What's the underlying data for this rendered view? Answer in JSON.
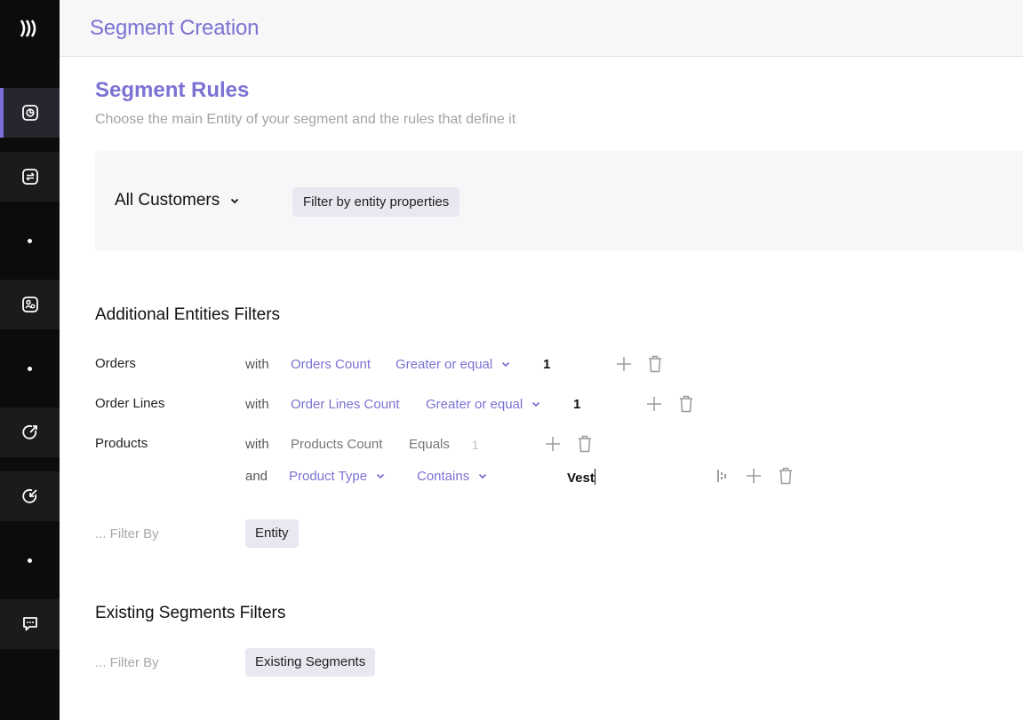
{
  "header": {
    "title": "Segment Creation"
  },
  "rules": {
    "title": "Segment Rules",
    "subtitle": "Choose the main Entity of your segment and the rules that define it",
    "entity": "All Customers",
    "filter_button": "Filter by entity properties"
  },
  "additional": {
    "title": "Additional Entities Filters",
    "rows": [
      {
        "entity": "Orders",
        "connector": "with",
        "field": "Orders Count",
        "operator": "Greater or equal",
        "value": "1"
      },
      {
        "entity": "Order Lines",
        "connector": "with",
        "field": "Order Lines Count",
        "operator": "Greater or equal",
        "value": "1"
      },
      {
        "entity": "Products",
        "connector": "with",
        "field": "Products Count",
        "operator": "Equals",
        "value": "1"
      }
    ],
    "and_row": {
      "connector": "and",
      "field": "Product Type",
      "operator": "Contains",
      "value": "Vest"
    },
    "filter_by_label": "... Filter By",
    "filter_by_button": "Entity"
  },
  "existing": {
    "title": "Existing Segments Filters",
    "filter_by_label": "... Filter By",
    "filter_by_button": "Existing Segments"
  },
  "colors": {
    "accent": "#7b72d3",
    "sidebar": "#0c0c0c",
    "chip": "#e8e8f0"
  },
  "icons": {
    "logo": "waves-logo",
    "nav": [
      "segments-icon",
      "exchange-icon",
      "dot",
      "audience-icon",
      "dot",
      "export-icon",
      "import-icon",
      "dot",
      "chat-icon"
    ],
    "row_actions": [
      "plus-icon",
      "trash-icon"
    ],
    "input_action": "column-picker-icon"
  }
}
